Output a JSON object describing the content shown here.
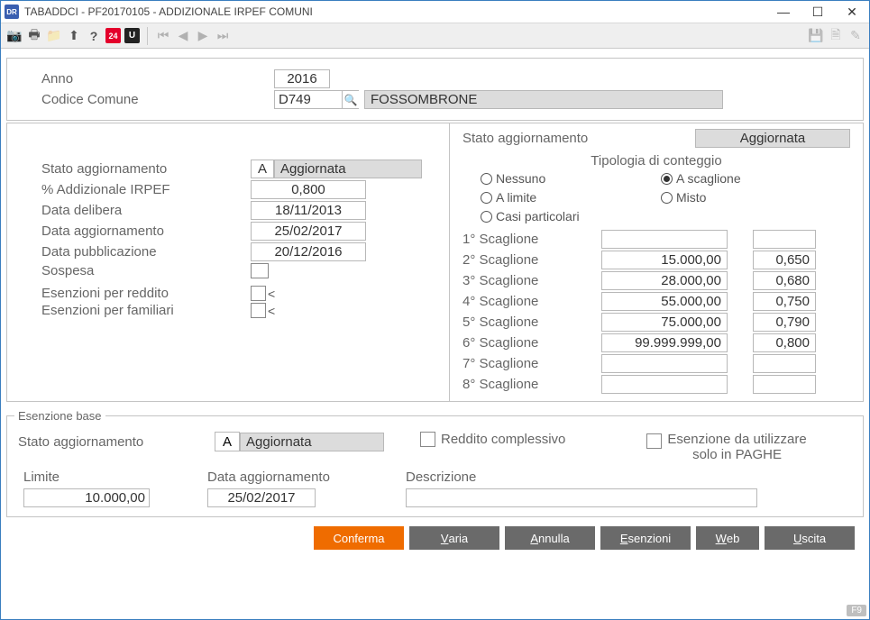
{
  "window": {
    "title": "TABADDCI  -  PF20170105 -   ADDIZIONALE IRPEF COMUNI"
  },
  "header": {
    "anno_label": "Anno",
    "anno": "2016",
    "codice_label": "Codice Comune",
    "codice": "D749",
    "comune": "FOSSOMBRONE"
  },
  "left": {
    "stato_label": "Stato aggiornamento",
    "stato_code": "A",
    "stato_text": "Aggiornata",
    "perc_label": "% Addizionale IRPEF",
    "perc": "0,800",
    "delibera_label": "Data delibera",
    "delibera": "18/11/2013",
    "agg_label": "Data aggiornamento",
    "agg": "25/02/2017",
    "pub_label": "Data pubblicazione",
    "pub": "20/12/2016",
    "sospesa_label": "Sospesa",
    "esen_redd_label": "Esenzioni per reddito",
    "esen_fam_label": "Esenzioni per familiari"
  },
  "right": {
    "stato_label": "Stato aggiornamento",
    "stato_text": "Aggiornata",
    "tipologia_label": "Tipologia di conteggio",
    "radios": {
      "nessuno": "Nessuno",
      "scaglione": "A scaglione",
      "limite": "A limite",
      "misto": "Misto",
      "casi": "Casi particolari"
    },
    "scaglioni": [
      {
        "label": "1° Scaglione",
        "amt": "",
        "pct": ""
      },
      {
        "label": "2° Scaglione",
        "amt": "15.000,00",
        "pct": "0,650"
      },
      {
        "label": "3° Scaglione",
        "amt": "28.000,00",
        "pct": "0,680"
      },
      {
        "label": "4° Scaglione",
        "amt": "55.000,00",
        "pct": "0,750"
      },
      {
        "label": "5° Scaglione",
        "amt": "75.000,00",
        "pct": "0,790"
      },
      {
        "label": "6° Scaglione",
        "amt": "99.999.999,00",
        "pct": "0,800"
      },
      {
        "label": "7° Scaglione",
        "amt": "",
        "pct": ""
      },
      {
        "label": "8° Scaglione",
        "amt": "",
        "pct": ""
      }
    ]
  },
  "esenzione": {
    "legend": "Esenzione base",
    "stato_label": "Stato aggiornamento",
    "stato_code": "A",
    "stato_text": "Aggiornata",
    "reddito_label": "Reddito complessivo",
    "paghe_label_1": "Esenzione da utilizzare",
    "paghe_label_2": "solo in PAGHE",
    "limite_label": "Limite",
    "limite": "10.000,00",
    "agg_label": "Data aggiornamento",
    "agg": "25/02/2017",
    "descr_label": "Descrizione",
    "descr": ""
  },
  "buttons": {
    "conferma": "Conferma",
    "varia": "Varia",
    "annulla": "Annulla",
    "esenzioni": "Esenzioni",
    "web": "Web",
    "uscita": "Uscita"
  },
  "footer_hint": "F9"
}
